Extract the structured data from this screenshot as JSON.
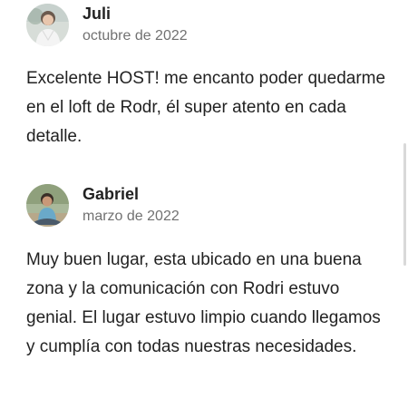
{
  "reviews": [
    {
      "name": "Juli",
      "date": "octubre de 2022",
      "text": "Excelente HOST! me encanto poder quedarme en el loft de Rodr, él super atento en cada detalle.",
      "avatar_icon": "person-photo-icon"
    },
    {
      "name": "Gabriel",
      "date": "marzo de 2022",
      "text": "Muy buen lugar, esta ubicado en una buena zona y la comunicación con Rodri estuvo genial. El lugar estuvo limpio cuando llegamos y cumplía con todas nuestras necesidades.",
      "avatar_icon": "person-photo-icon"
    }
  ],
  "colors": {
    "text": "#222222",
    "secondary_text": "#717171",
    "scrollbar": "#d9d9d9"
  }
}
